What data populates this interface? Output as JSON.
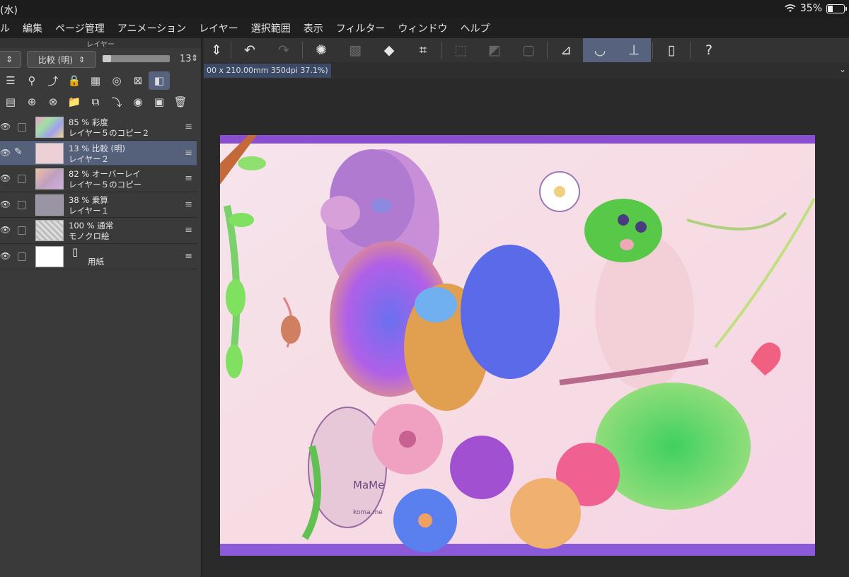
{
  "status": {
    "time": "(水)",
    "wifi_icon": "wifi-icon",
    "battery": "35%",
    "battery_level": 0.35
  },
  "menu": [
    "ル",
    "編集",
    "ページ管理",
    "アニメーション",
    "レイヤー",
    "選択範囲",
    "表示",
    "フィルター",
    "ウィンドウ",
    "ヘルプ"
  ],
  "panel": {
    "title": "レイヤー",
    "blend_mode": "比較 (明)",
    "opacity": "13",
    "opacity_fraction": 0.13
  },
  "layers": [
    {
      "l1": "85 % 彩度",
      "l2": "レイヤー５のコピー２",
      "thumb": "#e8a8d8",
      "selected": false
    },
    {
      "l1": "13 % 比較 (明)",
      "l2": "レイヤー２",
      "thumb": "#ecd0d6",
      "selected": true
    },
    {
      "l1": "82 % オーバーレイ",
      "l2": "レイヤー５のコピー",
      "thumb": "#d8c0d0",
      "selected": false
    },
    {
      "l1": "38 % 乗算",
      "l2": "レイヤー１",
      "thumb": "#9a94a4",
      "selected": false
    },
    {
      "l1": "100 % 通常",
      "l2": "モノクロ絵",
      "thumb": "#cfcfcf",
      "selected": false
    },
    {
      "l1": "",
      "l2": "用紙",
      "thumb": "#ffffff",
      "selected": false
    }
  ],
  "document_tab": "00 x 210.00mm 350dpi 37.1%)",
  "colors": {
    "accent": "#56627e",
    "panel": "#3a3a3a",
    "menubar": "#1f1f1f"
  },
  "canvas_art_text": [
    "MaMe",
    "koma.me"
  ]
}
